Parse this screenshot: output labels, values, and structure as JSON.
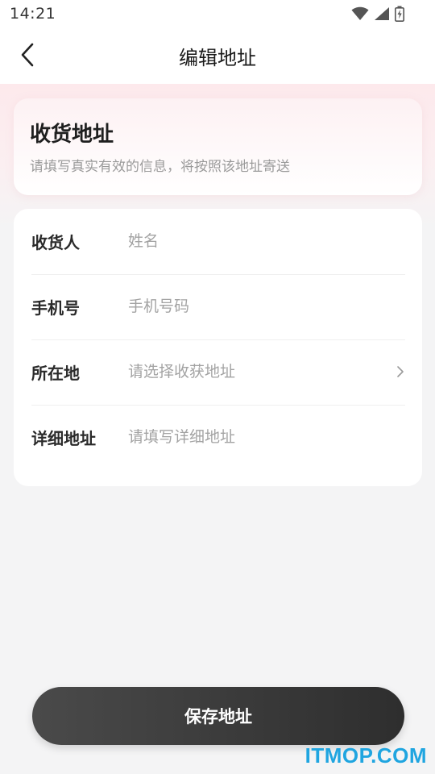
{
  "status_bar": {
    "time": "14:21"
  },
  "header": {
    "title": "编辑地址"
  },
  "intro": {
    "title": "收货地址",
    "subtitle": "请填写真实有效的信息，将按照该地址寄送"
  },
  "form": {
    "rows": [
      {
        "label": "收货人",
        "placeholder": "姓名",
        "value": ""
      },
      {
        "label": "手机号",
        "placeholder": "手机号码",
        "value": ""
      },
      {
        "label": "所在地",
        "placeholder": "请选择收获地址",
        "value": ""
      },
      {
        "label": "详细地址",
        "placeholder": "请填写详细地址",
        "value": ""
      }
    ]
  },
  "save_button": {
    "label": "保存地址"
  },
  "watermark": {
    "text": "ITMOP.COM",
    "color": "#1fa5e0"
  },
  "icons": {
    "back": "chevron-left-icon",
    "location_arrow": "chevron-right-icon",
    "wifi": "wifi-icon",
    "signal": "signal-icon",
    "battery": "battery-icon"
  }
}
